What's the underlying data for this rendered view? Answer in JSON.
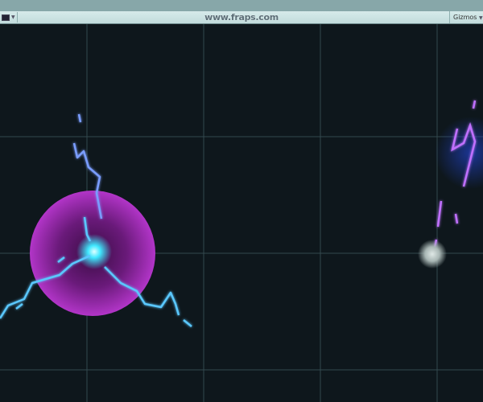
{
  "toolbar": {
    "watermark": "www.fraps.com",
    "gizmos_label": "Gizmos",
    "render_mode_icon": "image-icon"
  },
  "scene": {
    "background": "#0e171c",
    "grid_color": "#3a5358",
    "orb_color": "#b030c8",
    "core_color": "#4ff0ff",
    "lightning_color": "#3aa8ff"
  }
}
